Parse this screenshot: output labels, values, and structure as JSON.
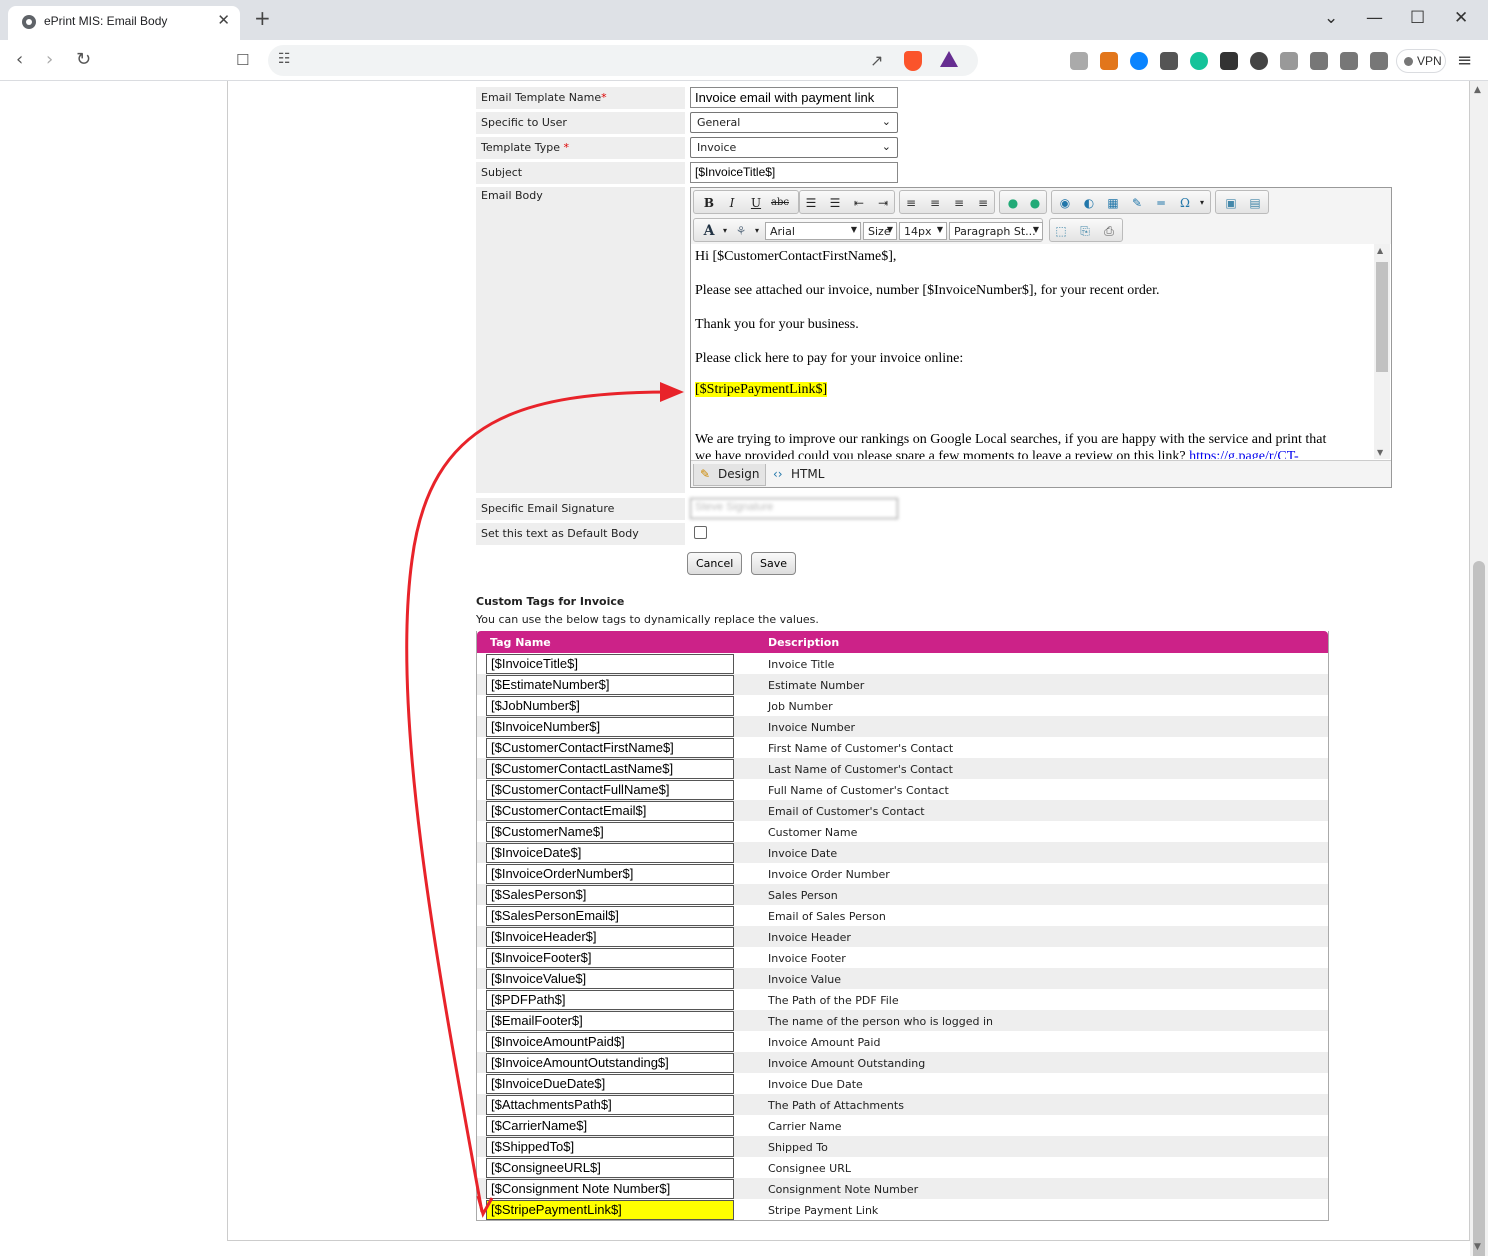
{
  "browser": {
    "tab_title": "ePrint MIS: Email Body",
    "tab_close": "✕",
    "new_tab": "+",
    "vpn_label": "VPN",
    "window_buttons": [
      "⌄",
      "—",
      "☐",
      "✕"
    ],
    "brand_color": "#fb542b"
  },
  "form": {
    "template_name_label": "Email Template Name",
    "template_name_value": "Invoice email with payment link",
    "specific_user_label": "Specific to User",
    "specific_user_value": "General",
    "template_type_label": "Template Type ",
    "template_type_value": "Invoice",
    "subject_label": "Subject",
    "subject_value": "[$InvoiceTitle$]",
    "email_body_label": "Email Body",
    "signature_label": "Specific Email Signature",
    "signature_value": "Steve Signature",
    "default_body_label": "Set this text as Default Body",
    "required_mark": "*",
    "cancel_label": "Cancel",
    "save_label": "Save"
  },
  "editor": {
    "font_family": "Arial",
    "font_size_label": "Size",
    "font_size_px": "14px",
    "paragraph_style": "Paragraph St...",
    "body_lines": [
      "Hi [$CustomerContactFirstName$],",
      "Please see attached our invoice, number [$InvoiceNumber$], for your recent order.",
      "Thank you for your business.",
      "Please click here to pay for your invoice online:",
      "[$StripePaymentLink$]",
      "We are trying to improve our rankings on Google Local searches, if you are happy with the service and print that",
      "we have provided could you please spare a few moments to leave a review on this link? "
    ],
    "review_link": "https://g.page/r/CT-",
    "design_tab": "Design",
    "html_tab": "HTML",
    "highlight_color": "#ffff00"
  },
  "tags": {
    "title": "Custom Tags for Invoice",
    "subtitle": "You can use the below tags to dynamically replace the values.",
    "col_tag": "Tag Name",
    "col_desc": "Description",
    "header_color": "#cc2288",
    "rows": [
      {
        "tag": "[$InvoiceTitle$]",
        "desc": "Invoice Title"
      },
      {
        "tag": "[$EstimateNumber$]",
        "desc": "Estimate Number"
      },
      {
        "tag": "[$JobNumber$]",
        "desc": "Job Number"
      },
      {
        "tag": "[$InvoiceNumber$]",
        "desc": "Invoice Number"
      },
      {
        "tag": "[$CustomerContactFirstName$]",
        "desc": "First Name of Customer's Contact"
      },
      {
        "tag": "[$CustomerContactLastName$]",
        "desc": "Last Name of Customer's Contact"
      },
      {
        "tag": "[$CustomerContactFullName$]",
        "desc": "Full Name of Customer's Contact"
      },
      {
        "tag": "[$CustomerContactEmail$]",
        "desc": "Email of Customer's Contact"
      },
      {
        "tag": "[$CustomerName$]",
        "desc": "Customer Name"
      },
      {
        "tag": "[$InvoiceDate$]",
        "desc": "Invoice Date"
      },
      {
        "tag": "[$InvoiceOrderNumber$]",
        "desc": "Invoice Order Number"
      },
      {
        "tag": "[$SalesPerson$]",
        "desc": " Sales Person"
      },
      {
        "tag": "[$SalesPersonEmail$]",
        "desc": "Email of Sales Person"
      },
      {
        "tag": "[$InvoiceHeader$]",
        "desc": "Invoice Header"
      },
      {
        "tag": "[$InvoiceFooter$]",
        "desc": "Invoice Footer"
      },
      {
        "tag": "[$InvoiceValue$]",
        "desc": "Invoice Value"
      },
      {
        "tag": "[$PDFPath$]",
        "desc": "The Path of the PDF File"
      },
      {
        "tag": "[$EmailFooter$]",
        "desc": "The name of the person who is logged in"
      },
      {
        "tag": "[$InvoiceAmountPaid$]",
        "desc": "Invoice Amount Paid"
      },
      {
        "tag": "[$InvoiceAmountOutstanding$]",
        "desc": "Invoice Amount Outstanding"
      },
      {
        "tag": "[$InvoiceDueDate$]",
        "desc": "Invoice Due Date"
      },
      {
        "tag": "[$AttachmentsPath$]",
        "desc": "The Path of Attachments"
      },
      {
        "tag": "[$CarrierName$]",
        "desc": "Carrier Name"
      },
      {
        "tag": "[$ShippedTo$]",
        "desc": "Shipped To"
      },
      {
        "tag": "[$ConsigneeURL$]",
        "desc": "Consignee URL"
      },
      {
        "tag": "[$Consignment Note Number$]",
        "desc": "Consignment Note Number"
      },
      {
        "tag": "[$StripePaymentLink$]",
        "desc": "Stripe Payment Link"
      }
    ]
  },
  "annotation": {
    "arrow_color": "#e8232a"
  }
}
